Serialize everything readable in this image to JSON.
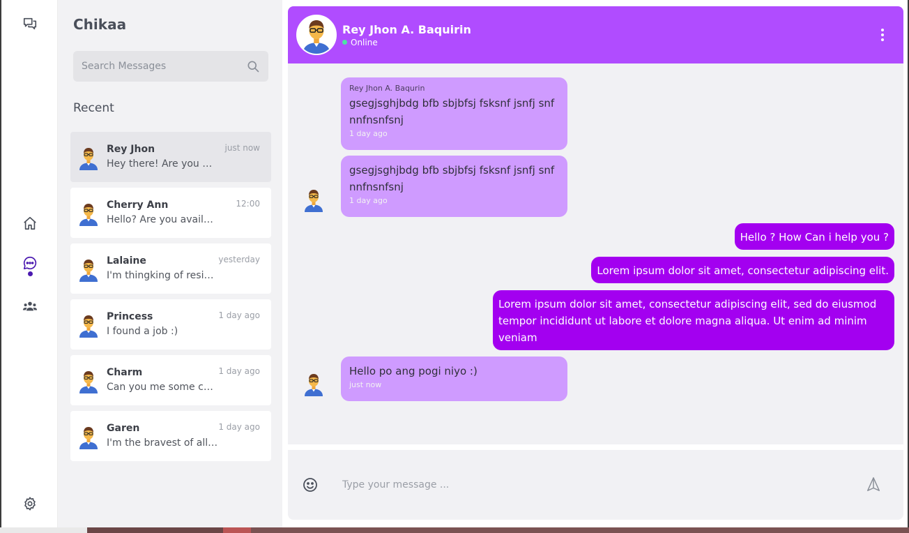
{
  "app": {
    "brand": "Chikaa"
  },
  "colors": {
    "accent": "#b04cff",
    "incoming_bubble": "#cf9bff",
    "outgoing_bubble": "#a300f0",
    "online": "#4ee2a5",
    "nav_active": "#4b1ab0"
  },
  "rail": {
    "items": [
      {
        "icon": "chat-bubbles-icon"
      },
      {
        "icon": "home-icon"
      },
      {
        "icon": "chat-icon",
        "active": true
      },
      {
        "icon": "people-icon"
      },
      {
        "icon": "gear-icon"
      }
    ]
  },
  "search": {
    "placeholder": "Search Messages",
    "icon": "search-icon"
  },
  "sidebar": {
    "recent_label": "Recent"
  },
  "contacts": [
    {
      "name": "Rey Jhon",
      "time": "just now",
      "message": "Hey there! Are you finish creating the chat app?",
      "active": true
    },
    {
      "name": "Cherry Ann",
      "time": "12:00",
      "message": "Hello? Are you available tonight?"
    },
    {
      "name": "Lalaine",
      "time": "yesterday",
      "message": "I'm thingking of resigning"
    },
    {
      "name": "Princess",
      "time": "1 day ago",
      "message": "I found a job :)"
    },
    {
      "name": "Charm",
      "time": "1 day ago",
      "message": "Can you me some chocolates?"
    },
    {
      "name": "Garen",
      "time": "1 day ago",
      "message": "I'm the bravest of all kind"
    }
  ],
  "chat": {
    "name": "Rey Jhon A. Baquirin",
    "status": "Online",
    "menu_icon": "kebab-menu-icon",
    "messages": [
      {
        "direction": "in",
        "sender": "Rey Jhon A. Baqurin",
        "text": "gsegjsghjbdg bfb sbjbfsj fsksnf jsnfj snf nnfnsnfsnj",
        "stamp": "1 day ago"
      },
      {
        "direction": "in",
        "text": "gsegjsghjbdg bfb sbjbfsj fsksnf jsnfj snf nnfnsnfsnj",
        "stamp": "1 day ago"
      },
      {
        "direction": "out",
        "text": "Hello ? How Can i help you ?"
      },
      {
        "direction": "out",
        "text": "Lorem ipsum dolor sit amet, consectetur adipiscing elit."
      },
      {
        "direction": "out",
        "text": "Lorem ipsum dolor sit amet, consectetur adipiscing elit, sed do eiusmod tempor incididunt ut labore et dolore magna aliqua. Ut enim ad minim veniam"
      },
      {
        "direction": "in",
        "text": "Hello po ang pogi niyo :)",
        "stamp": "just now"
      }
    ]
  },
  "composer": {
    "placeholder": "Type your message ...",
    "emoji_icon": "emoji-icon",
    "send_icon": "send-icon"
  }
}
